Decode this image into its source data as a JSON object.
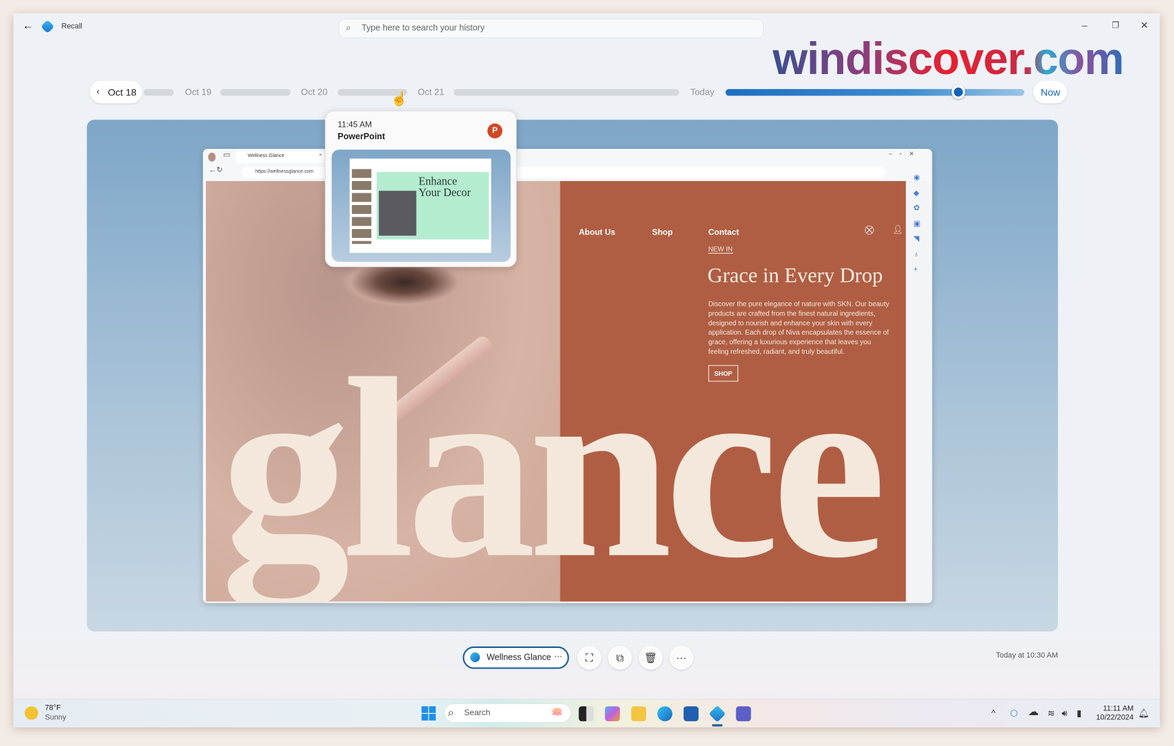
{
  "app": {
    "title": "Recall",
    "search_placeholder": "Type here to search your history"
  },
  "watermark": "windiscover.com",
  "timeline": {
    "back_label": "Oct 18",
    "labels": [
      "Oct 19",
      "Oct 20",
      "Oct 21",
      "Today"
    ],
    "now_label": "Now",
    "position_percent": 78
  },
  "hover_card": {
    "time": "11:45 AM",
    "app": "PowerPoint",
    "slide_title_1": "Enhance",
    "slide_title_2": "Your Decor"
  },
  "browser": {
    "tab_title": "Wellness Glance",
    "url": "https://wellnessglance.com"
  },
  "site": {
    "nav": [
      "About Us",
      "Shop",
      "Contact"
    ],
    "eyebrow": "NEW IN",
    "heading": "Grace in Every Drop",
    "body": "Discover the pure elegance of nature with SKN. Our beauty products are crafted from the finest natural ingredients, designed to nourish and enhance your skin with every application. Each drop of Niva encapsulates the essence of grace, offering a luxurious experience that leaves you feeling refreshed, radiant, and truly beautiful.",
    "shop_button": "SHOP",
    "hero_word": "glance",
    "accent": "#b05e43"
  },
  "snapshot_bar": {
    "app_chip": "Wellness Glance",
    "more": "···",
    "timestamp": "Today at 10:30 AM"
  },
  "taskbar": {
    "weather_temp": "78°F",
    "weather_desc": "Sunny",
    "search_label": "Search",
    "time": "11:11 AM",
    "date": "10/22/2024"
  }
}
